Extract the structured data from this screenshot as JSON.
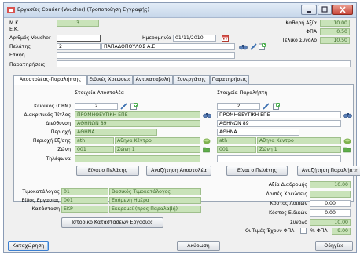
{
  "window": {
    "title": "Εργασίες Courier (Voucher) (Τροποποίηση Εγγραφής)"
  },
  "header": {
    "mk_label": "Μ.Κ.",
    "mk_value": "3",
    "ek_label": "Ε.Κ.",
    "voucher_label": "Αριθμός Voucher",
    "voucher_value": "",
    "date_label": "Ημερομηνία",
    "date_value": "01/11/2010",
    "customer_label": "Πελάτης",
    "customer_code": "2",
    "customer_name": "ΠΑΠΑΔΟΠΟΥΛΟΣ Α.Ε",
    "contact_label": "Επαφή",
    "contact_value": "",
    "notes_label": "Παρατηρήσεις",
    "notes_value": "",
    "net_label": "Καθαρή Αξία",
    "net_value": "10.00",
    "vat_label": "ΦΠΑ",
    "vat_value": "0.50",
    "total_label": "Τελικό Σύνολο",
    "total_value": "10.50"
  },
  "tabs": [
    {
      "label": "Αποστολέας-Παραλήπτης"
    },
    {
      "label": "Ειδικές Χρεώσεις"
    },
    {
      "label": "Αντικαταβολή"
    },
    {
      "label": "Συνεργάτης"
    },
    {
      "label": "Παρατηρήσεις"
    }
  ],
  "sender": {
    "section_title": "Στοιχεία Αποστολέα",
    "code": "2",
    "title": "ΠΡΟΜΗΘΕΥΤΙΚΗ ΕΠΕ",
    "address": "ΑΘΗΝΩΝ 89",
    "area": "ΑΘΗΝΑ",
    "area_code": "ath",
    "area_name": "Αθηνα Κέντρο",
    "zone_code": "001",
    "zone_name": "Ζώνη 1",
    "phone": "",
    "is_customer_btn": "Είναι ο Πελάτης",
    "search_btn": "Αναζήτηση Αποστολέα"
  },
  "receiver": {
    "section_title": "Στοιχεία Παραλήπτη",
    "code": "2",
    "title": "ΠΡΟΜΗΘΕΥΤΙΚΗ ΕΠΕ",
    "address": "ΑΘΗΝΩΝ 89",
    "area": "ΑΘΗΝΑ",
    "area_code": "ath",
    "area_name": "Αθηνα Κέντρο",
    "zone_code": "001",
    "zone_name": "Ζώνη 1",
    "phone": "",
    "is_customer_btn": "Είναι ο Πελάτης",
    "search_btn": "Αναζήτηση Παραλήπτη"
  },
  "row_labels": {
    "code": "Κωδικός (CRM)",
    "title": "Διακριτικός Τίτλος",
    "address": "Διεύθυνση",
    "area": "Περιοχή",
    "area_ext": "Περιοχή Εξ/σης",
    "zone": "Ζώνη",
    "phone": "Τηλέφωνα"
  },
  "bottom": {
    "pricelist_label": "Τιμοκατάλογος",
    "pricelist_code": "01",
    "pricelist_name": "Βασικός Τιμοκατάλογος",
    "worktype_label": "Είδος Εργασίας",
    "worktype_code": "001",
    "worktype_name": "Επόμενη Ημέρα",
    "status_label": "Κατάσταση",
    "status_code": "EKP",
    "status_name": "Εκκρεμεί (προς Παραλαβή)",
    "history_btn": "Ιστορικό Καταστάσεων Εργασίας",
    "delivery_value_label": "Αξία Διαδρομής",
    "delivery_value": "10.00",
    "other_charges_label": "Λοιπές Χρεώσεις",
    "other_charges_value": "",
    "other_cost_label": "Κόστος Λοιπών",
    "other_cost_value": "0.00",
    "special_cost_label": "Κόστος Ειδικών",
    "special_cost_value": "0.00",
    "sum_label": "Σύνολο",
    "sum_value": "10.00",
    "vat_incl_label": "Οι Τιμές Έχουν ΦΠΑ",
    "vat_pct_label": "% ΦΠΑ",
    "vat_pct_value": "9.00"
  },
  "footer": {
    "save_btn": "Καταχώρηση",
    "cancel_btn": "Ακύρωση",
    "help_btn": "Οδηγίες"
  },
  "colors": {
    "green_field": "#c9e3b9",
    "green_text": "#3c6a2a",
    "title_gradient_top": "#e2ecf7",
    "close_red": "#c9473a"
  }
}
